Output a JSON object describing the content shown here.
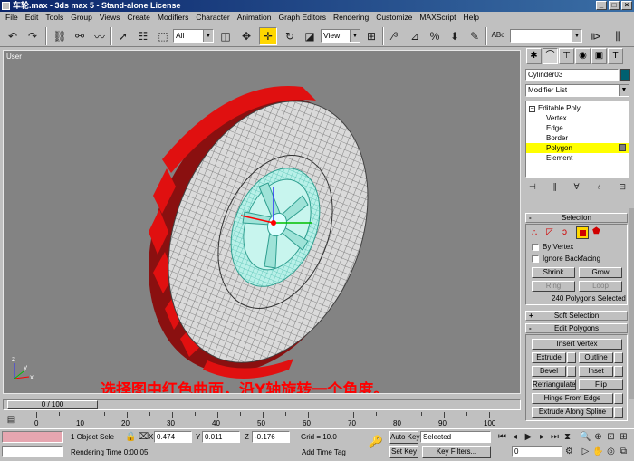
{
  "window": {
    "title": "车轮.max - 3ds max 5 - Stand-alone License",
    "buttons": [
      "_",
      "□",
      "×"
    ]
  },
  "menu": [
    "File",
    "Edit",
    "Tools",
    "Group",
    "Views",
    "Create",
    "Modifiers",
    "Character",
    "Animation",
    "Graph Editors",
    "Rendering",
    "Customize",
    "MAXScript",
    "Help"
  ],
  "toolbar": {
    "selection_filter": "All",
    "reference_coord": "View",
    "named_selection": ""
  },
  "viewport": {
    "label": "User",
    "caption": "选择图中红色曲面，沿Y轴旋转一个角度。",
    "axis_x": "x",
    "axis_y": "y",
    "axis_z": "z"
  },
  "command_panel": {
    "tabs": [
      "create-icon",
      "modify-icon",
      "hierarchy-icon",
      "motion-icon",
      "display-icon",
      "utilities-icon"
    ],
    "object_name": "Cylinder03",
    "object_color": "#006070",
    "modifier_list": "Modifier List",
    "stack": {
      "root": "Editable Poly",
      "items": [
        "Vertex",
        "Edge",
        "Border",
        "Polygon",
        "Element"
      ],
      "selected": "Polygon"
    },
    "selection": {
      "title": "Selection",
      "by_vertex": "By Vertex",
      "ignore_backfacing": "Ignore Backfacing",
      "shrink": "Shrink",
      "grow": "Grow",
      "ring": "Ring",
      "loop": "Loop",
      "status": "240 Polygons Selected"
    },
    "soft_selection": {
      "title": "Soft Selection"
    },
    "edit_polygons": {
      "title": "Edit Polygons",
      "insert_vertex": "Insert Vertex",
      "extrude": "Extrude",
      "outline": "Outline",
      "bevel": "Bevel",
      "inset": "Inset",
      "retriangulate": "Retriangulate",
      "flip": "Flip",
      "hinge_from_edge": "Hinge From Edge",
      "extrude_along_spline": "Extrude Along Spline"
    }
  },
  "timeline": {
    "frame": "0 / 100",
    "ticks": [
      "0",
      "10",
      "20",
      "30",
      "40",
      "50",
      "60",
      "70",
      "80",
      "90",
      "100"
    ]
  },
  "status": {
    "selection": "1 Object Sele",
    "x_label": "X",
    "y_label": "Y",
    "z_label": "Z",
    "x": "0.474",
    "y": "0.011",
    "z": "-0.176",
    "grid": "Grid = 10.0",
    "render_time": "Rendering Time  0:00:05",
    "add_time_tag": "Add Time Tag",
    "auto_key": "Auto Key",
    "set_key": "Set Key",
    "key_mode": "Selected",
    "key_filters": "Key Filters...",
    "current_frame": "0"
  }
}
